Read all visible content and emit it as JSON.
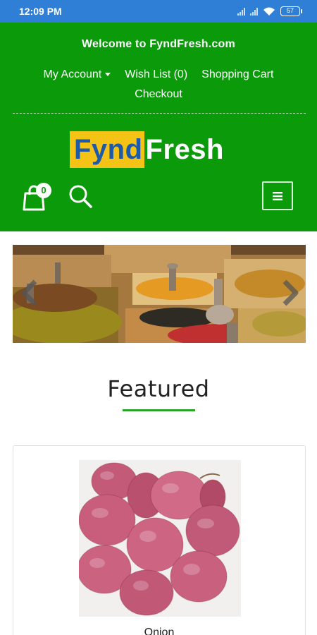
{
  "status_bar": {
    "time": "12:09 PM",
    "battery": "57"
  },
  "header": {
    "welcome": "Welcome to FyndFresh.com",
    "links": {
      "my_account": "My Account",
      "wish_list": "Wish List (0)",
      "shopping_cart": "Shopping Cart",
      "checkout": "Checkout"
    },
    "logo": {
      "part1": "Fynd",
      "part2": "Fresh"
    },
    "cart_count": "0",
    "colors": {
      "header_bg": "#0a9a0a",
      "logo_yellow": "#f5c316",
      "logo_blue": "#1f5aa8"
    },
    "icons": [
      "cart-bag-icon",
      "search-icon",
      "hamburger-menu-icon"
    ]
  },
  "banner": {
    "icons": [
      "chevron-left-icon",
      "chevron-right-icon"
    ]
  },
  "featured": {
    "title": "Featured",
    "products": [
      {
        "name": "Onion"
      }
    ]
  }
}
